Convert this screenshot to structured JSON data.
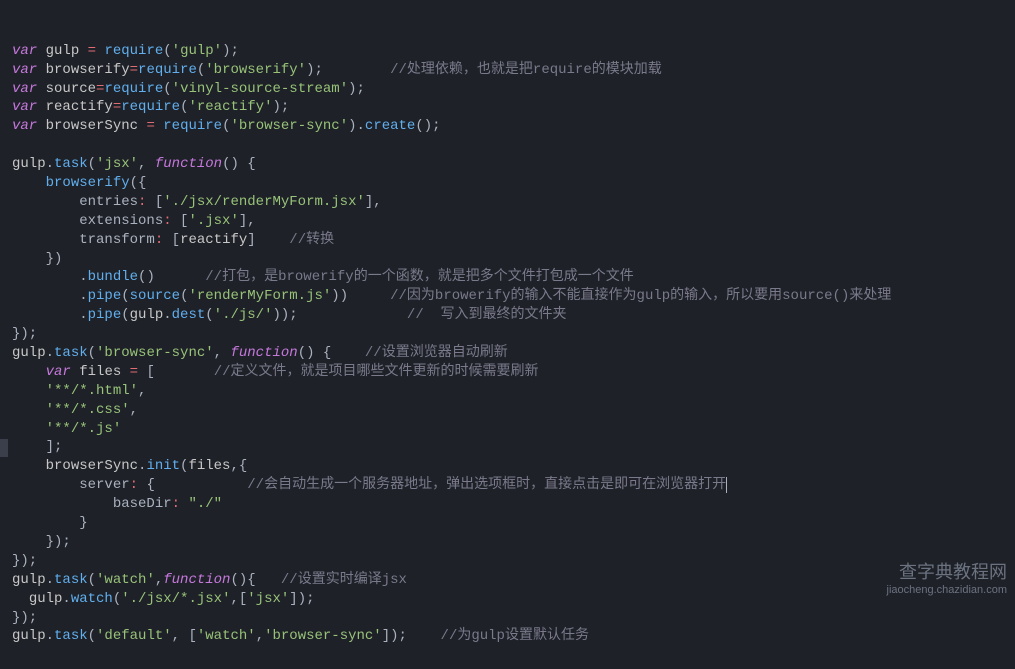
{
  "lines": [
    {
      "t": [
        [
          "kw",
          "var"
        ],
        [
          "",
          ", "
        ],
        [
          "var",
          "gulp"
        ],
        [
          "",
          " "
        ],
        [
          "op",
          "="
        ],
        [
          "",
          " "
        ],
        [
          "fn",
          "require"
        ],
        [
          "punct",
          "("
        ],
        [
          "str",
          "'gulp'"
        ],
        [
          "punct",
          ");"
        ]
      ]
    },
    {
      "t": [
        [
          "kw",
          "var"
        ],
        [
          "",
          " "
        ],
        [
          "var",
          "browserify"
        ],
        [
          "op",
          "="
        ],
        [
          "fn",
          "require"
        ],
        [
          "punct",
          "("
        ],
        [
          "str",
          "'browserify'"
        ],
        [
          "punct",
          ");"
        ],
        [
          "",
          "        "
        ],
        [
          "comment",
          "//处理依赖，也就是把require的模块加载"
        ]
      ]
    },
    {
      "t": [
        [
          "kw",
          "var"
        ],
        [
          "",
          " "
        ],
        [
          "var",
          "source"
        ],
        [
          "op",
          "="
        ],
        [
          "fn",
          "require"
        ],
        [
          "punct",
          "("
        ],
        [
          "str",
          "'vinyl-source-stream'"
        ],
        [
          "punct",
          ");"
        ]
      ]
    },
    {
      "t": [
        [
          "kw",
          "var"
        ],
        [
          "",
          " "
        ],
        [
          "var",
          "reactify"
        ],
        [
          "op",
          "="
        ],
        [
          "fn",
          "require"
        ],
        [
          "punct",
          "("
        ],
        [
          "str",
          "'reactify'"
        ],
        [
          "punct",
          ");"
        ]
      ]
    },
    {
      "t": [
        [
          "kw",
          "var"
        ],
        [
          "",
          " "
        ],
        [
          "var",
          "browserSync"
        ],
        [
          "",
          " "
        ],
        [
          "op",
          "="
        ],
        [
          "",
          " "
        ],
        [
          "fn",
          "require"
        ],
        [
          "punct",
          "("
        ],
        [
          "str",
          "'browser-sync'"
        ],
        [
          "punct",
          ")."
        ],
        [
          "fn",
          "create"
        ],
        [
          "punct",
          "();"
        ]
      ]
    },
    {
      "t": [
        [
          "",
          ""
        ]
      ]
    },
    {
      "t": [
        [
          "var",
          "gulp"
        ],
        [
          "punct",
          "."
        ],
        [
          "fn",
          "task"
        ],
        [
          "punct",
          "("
        ],
        [
          "str",
          "'jsx'"
        ],
        [
          "punct",
          ", "
        ],
        [
          "kw",
          "function"
        ],
        [
          "punct",
          "() {"
        ]
      ]
    },
    {
      "t": [
        [
          "",
          "    "
        ],
        [
          "fn",
          "browserify"
        ],
        [
          "punct",
          "({"
        ]
      ]
    },
    {
      "t": [
        [
          "",
          "        "
        ],
        [
          "prop",
          "entries"
        ],
        [
          "op",
          ":"
        ],
        [
          "",
          " "
        ],
        [
          "punct",
          "["
        ],
        [
          "str",
          "'./jsx/renderMyForm.jsx'"
        ],
        [
          "punct",
          "],"
        ]
      ]
    },
    {
      "t": [
        [
          "",
          "        "
        ],
        [
          "prop",
          "extensions"
        ],
        [
          "op",
          ":"
        ],
        [
          "",
          " "
        ],
        [
          "punct",
          "["
        ],
        [
          "str",
          "'.jsx'"
        ],
        [
          "punct",
          "],"
        ]
      ]
    },
    {
      "t": [
        [
          "",
          "        "
        ],
        [
          "prop",
          "transform"
        ],
        [
          "op",
          ":"
        ],
        [
          "",
          " "
        ],
        [
          "punct",
          "["
        ],
        [
          "var",
          "reactify"
        ],
        [
          "punct",
          "]"
        ],
        [
          "",
          "    "
        ],
        [
          "comment",
          "//转换"
        ]
      ]
    },
    {
      "t": [
        [
          "",
          "    "
        ],
        [
          "punct",
          "})"
        ]
      ]
    },
    {
      "t": [
        [
          "",
          "        "
        ],
        [
          "punct",
          "."
        ],
        [
          "fn",
          "bundle"
        ],
        [
          "punct",
          "()"
        ],
        [
          "",
          "      "
        ],
        [
          "comment",
          "//打包，是browerify的一个函数，就是把多个文件打包成一个文件"
        ]
      ]
    },
    {
      "t": [
        [
          "",
          "        "
        ],
        [
          "punct",
          "."
        ],
        [
          "fn",
          "pipe"
        ],
        [
          "punct",
          "("
        ],
        [
          "fn",
          "source"
        ],
        [
          "punct",
          "("
        ],
        [
          "str",
          "'renderMyForm.js'"
        ],
        [
          "punct",
          "))"
        ],
        [
          "",
          "     "
        ],
        [
          "comment",
          "//因为browerify的输入不能直接作为gulp的输入，所以要用source()来处理"
        ]
      ]
    },
    {
      "t": [
        [
          "",
          "        "
        ],
        [
          "punct",
          "."
        ],
        [
          "fn",
          "pipe"
        ],
        [
          "punct",
          "("
        ],
        [
          "var",
          "gulp"
        ],
        [
          "punct",
          "."
        ],
        [
          "fn",
          "dest"
        ],
        [
          "punct",
          "("
        ],
        [
          "str",
          "'./js/'"
        ],
        [
          "punct",
          "));"
        ],
        [
          "",
          "             "
        ],
        [
          "comment",
          "//  写入到最终的文件夹"
        ]
      ]
    },
    {
      "t": [
        [
          "punct",
          "});"
        ]
      ]
    },
    {
      "t": [
        [
          "var",
          "gulp"
        ],
        [
          "punct",
          "."
        ],
        [
          "fn",
          "task"
        ],
        [
          "punct",
          "("
        ],
        [
          "str",
          "'browser-sync'"
        ],
        [
          "punct",
          ", "
        ],
        [
          "kw",
          "function"
        ],
        [
          "punct",
          "() {"
        ],
        [
          "",
          "    "
        ],
        [
          "comment",
          "//设置浏览器自动刷新"
        ]
      ]
    },
    {
      "t": [
        [
          "",
          "    "
        ],
        [
          "kw",
          "var"
        ],
        [
          "",
          " "
        ],
        [
          "var",
          "files"
        ],
        [
          "",
          " "
        ],
        [
          "op",
          "="
        ],
        [
          "",
          " "
        ],
        [
          "punct",
          "["
        ],
        [
          "",
          "       "
        ],
        [
          "comment",
          "//定义文件，就是项目哪些文件更新的时候需要刷新"
        ]
      ]
    },
    {
      "t": [
        [
          "",
          "    "
        ],
        [
          "str",
          "'**/*.html'"
        ],
        [
          "punct",
          ","
        ]
      ]
    },
    {
      "t": [
        [
          "",
          "    "
        ],
        [
          "str",
          "'**/*.css'"
        ],
        [
          "punct",
          ","
        ]
      ]
    },
    {
      "t": [
        [
          "",
          "    "
        ],
        [
          "str",
          "'**/*.js'"
        ]
      ]
    },
    {
      "t": [
        [
          "",
          "    "
        ],
        [
          "punct",
          "];"
        ]
      ]
    },
    {
      "t": [
        [
          "",
          "    "
        ],
        [
          "var",
          "browserSync"
        ],
        [
          "punct",
          "."
        ],
        [
          "fn",
          "init"
        ],
        [
          "punct",
          "("
        ],
        [
          "var",
          "files"
        ],
        [
          "punct",
          ",{"
        ]
      ]
    },
    {
      "t": [
        [
          "",
          "        "
        ],
        [
          "prop",
          "server"
        ],
        [
          "op",
          ":"
        ],
        [
          "",
          " "
        ],
        [
          "punct",
          "{"
        ],
        [
          "",
          "           "
        ],
        [
          "comment",
          "//会自动生成一个服务器地址，弹出选项框时，直接点击是即可在浏览器打开"
        ]
      ],
      "cursor": true
    },
    {
      "t": [
        [
          "",
          "            "
        ],
        [
          "prop",
          "baseDir"
        ],
        [
          "op",
          ":"
        ],
        [
          "",
          " "
        ],
        [
          "str",
          "\"./\""
        ]
      ]
    },
    {
      "t": [
        [
          "",
          "        "
        ],
        [
          "punct",
          "}"
        ]
      ]
    },
    {
      "t": [
        [
          "",
          "    "
        ],
        [
          "punct",
          "});"
        ]
      ]
    },
    {
      "t": [
        [
          "punct",
          "});"
        ]
      ]
    },
    {
      "t": [
        [
          "var",
          "gulp"
        ],
        [
          "punct",
          "."
        ],
        [
          "fn",
          "task"
        ],
        [
          "punct",
          "("
        ],
        [
          "str",
          "'watch'"
        ],
        [
          "punct",
          ","
        ],
        [
          "kw",
          "function"
        ],
        [
          "punct",
          "(){"
        ],
        [
          "",
          "   "
        ],
        [
          "comment",
          "//设置实时编译jsx"
        ]
      ]
    },
    {
      "t": [
        [
          "",
          "  "
        ],
        [
          "var",
          "gulp"
        ],
        [
          "punct",
          "."
        ],
        [
          "fn",
          "watch"
        ],
        [
          "punct",
          "("
        ],
        [
          "str",
          "'./jsx/*.jsx'"
        ],
        [
          "punct",
          ",["
        ],
        [
          "str",
          "'jsx'"
        ],
        [
          "punct",
          "]);"
        ]
      ]
    },
    {
      "t": [
        [
          "punct",
          "});"
        ]
      ]
    },
    {
      "t": [
        [
          "var",
          "gulp"
        ],
        [
          "punct",
          "."
        ],
        [
          "fn",
          "task"
        ],
        [
          "punct",
          "("
        ],
        [
          "str",
          "'default'"
        ],
        [
          "punct",
          ", ["
        ],
        [
          "str",
          "'watch'"
        ],
        [
          "punct",
          ","
        ],
        [
          "str",
          "'browser-sync'"
        ],
        [
          "punct",
          "]);"
        ],
        [
          "",
          "    "
        ],
        [
          "comment",
          "//为gulp设置默认任务"
        ]
      ]
    }
  ],
  "watermark": {
    "main": "查字典教程网",
    "sub": "jiaocheng.chazidian.com"
  },
  "gutter_mark_line": 23
}
